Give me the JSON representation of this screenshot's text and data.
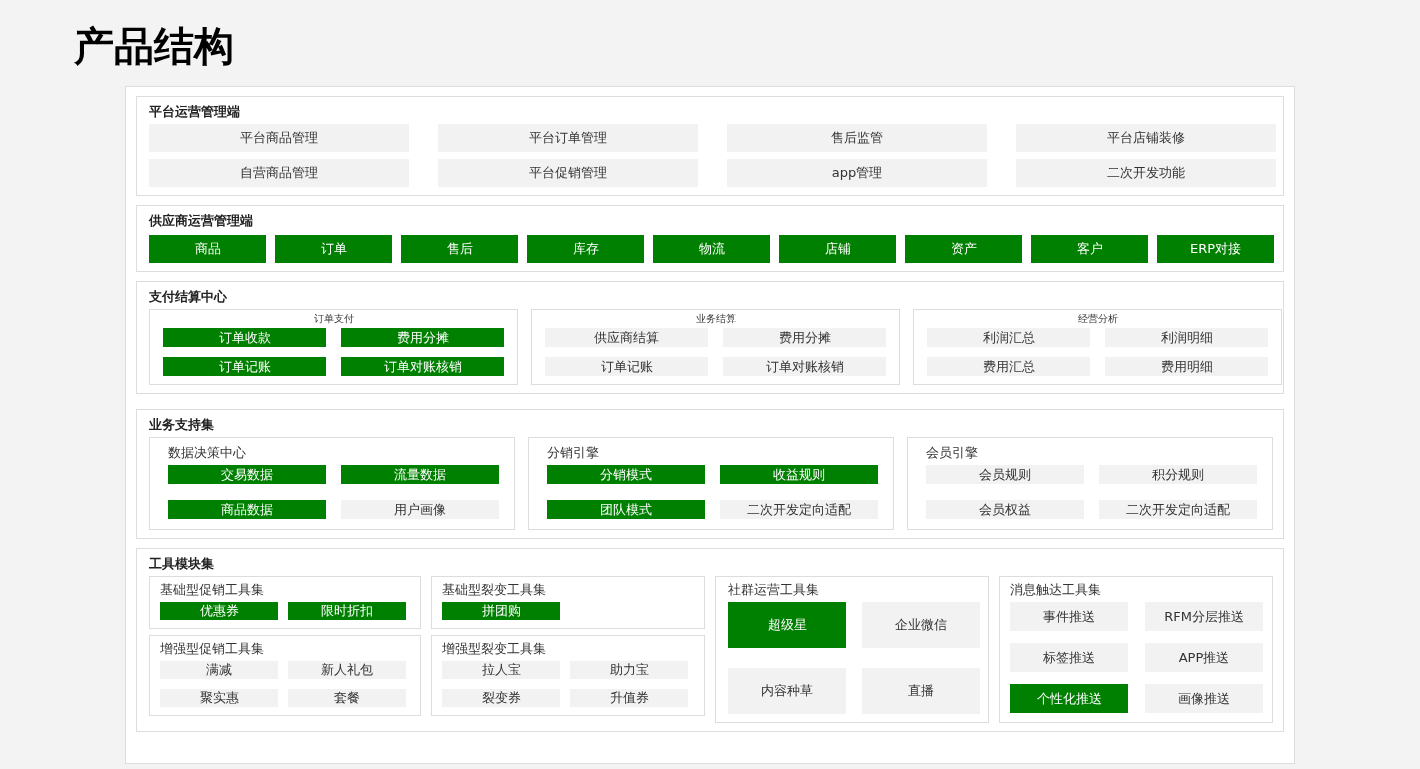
{
  "title": "产品结构",
  "sections": [
    {
      "kind": "tiles",
      "title": "平台运营管理端",
      "items": [
        {
          "label": "平台商品管理",
          "highlighted": false
        },
        {
          "label": "平台订单管理",
          "highlighted": false
        },
        {
          "label": "售后监管",
          "highlighted": false
        },
        {
          "label": "平台店铺装修",
          "highlighted": false
        },
        {
          "label": "自营商品管理",
          "highlighted": false
        },
        {
          "label": "平台促销管理",
          "highlighted": false
        },
        {
          "label": "app管理",
          "highlighted": false
        },
        {
          "label": "二次开发功能",
          "highlighted": false
        }
      ]
    },
    {
      "kind": "strip",
      "title": "供应商运营管理端",
      "items": [
        {
          "label": "商品",
          "highlighted": true
        },
        {
          "label": "订单",
          "highlighted": true
        },
        {
          "label": "售后",
          "highlighted": true
        },
        {
          "label": "库存",
          "highlighted": true
        },
        {
          "label": "物流",
          "highlighted": true
        },
        {
          "label": "店铺",
          "highlighted": true
        },
        {
          "label": "资产",
          "highlighted": true
        },
        {
          "label": "客户",
          "highlighted": true
        },
        {
          "label": "ERP对接",
          "highlighted": true
        }
      ]
    },
    {
      "kind": "compact-groups",
      "title": "支付结算中心",
      "groups": [
        {
          "title": "订单支付",
          "items": [
            {
              "label": "订单收款",
              "highlighted": true
            },
            {
              "label": "费用分摊",
              "highlighted": true
            },
            {
              "label": "订单记账",
              "highlighted": true
            },
            {
              "label": "订单对账核销",
              "highlighted": true
            }
          ]
        },
        {
          "title": "业务结算",
          "items": [
            {
              "label": "供应商结算",
              "highlighted": false
            },
            {
              "label": "费用分摊",
              "highlighted": false
            },
            {
              "label": "订单记账",
              "highlighted": false
            },
            {
              "label": "订单对账核销",
              "highlighted": false
            }
          ]
        },
        {
          "title": "经营分析",
          "items": [
            {
              "label": "利润汇总",
              "highlighted": false
            },
            {
              "label": "利润明细",
              "highlighted": false
            },
            {
              "label": "费用汇总",
              "highlighted": false
            },
            {
              "label": "费用明细",
              "highlighted": false
            }
          ]
        }
      ]
    },
    {
      "kind": "groups",
      "title": "业务支持集",
      "groups": [
        {
          "title": "数据决策中心",
          "items": [
            {
              "label": "交易数据",
              "highlighted": true
            },
            {
              "label": "流量数据",
              "highlighted": true
            },
            {
              "label": "商品数据",
              "highlighted": true
            },
            {
              "label": "用户画像",
              "highlighted": false
            }
          ]
        },
        {
          "title": "分销引擎",
          "items": [
            {
              "label": "分销模式",
              "highlighted": true
            },
            {
              "label": "收益规则",
              "highlighted": true
            },
            {
              "label": "团队模式",
              "highlighted": true
            },
            {
              "label": "二次开发定向适配",
              "highlighted": false
            }
          ]
        },
        {
          "title": "会员引擎",
          "items": [
            {
              "label": "会员规则",
              "highlighted": false
            },
            {
              "label": "积分规则",
              "highlighted": false
            },
            {
              "label": "会员权益",
              "highlighted": false
            },
            {
              "label": "二次开发定向适配",
              "highlighted": false
            }
          ]
        }
      ]
    },
    {
      "kind": "tools",
      "title": "工具模块集",
      "columns": [
        {
          "groups": [
            {
              "kind": "small",
              "title": "基础型促销工具集",
              "items": [
                {
                  "label": "优惠券",
                  "highlighted": true
                },
                {
                  "label": "限时折扣",
                  "highlighted": true
                }
              ]
            },
            {
              "kind": "small",
              "title": "增强型促销工具集",
              "items": [
                {
                  "label": "满减",
                  "highlighted": false
                },
                {
                  "label": "新人礼包",
                  "highlighted": false
                },
                {
                  "label": "聚实惠",
                  "highlighted": false
                },
                {
                  "label": "套餐",
                  "highlighted": false
                }
              ]
            }
          ]
        },
        {
          "groups": [
            {
              "kind": "small",
              "title": "基础型裂变工具集",
              "items": [
                {
                  "label": "拼团购",
                  "highlighted": true
                }
              ]
            },
            {
              "kind": "small",
              "title": "增强型裂变工具集",
              "items": [
                {
                  "label": "拉人宝",
                  "highlighted": false
                },
                {
                  "label": "助力宝",
                  "highlighted": false
                },
                {
                  "label": "裂变券",
                  "highlighted": false
                },
                {
                  "label": "升值券",
                  "highlighted": false
                }
              ]
            }
          ]
        },
        {
          "groups": [
            {
              "kind": "large",
              "title": "社群运营工具集",
              "items": [
                {
                  "label": "超级星",
                  "highlighted": true
                },
                {
                  "label": "企业微信",
                  "highlighted": false
                },
                {
                  "label": "内容种草",
                  "highlighted": false
                },
                {
                  "label": "直播",
                  "highlighted": false
                }
              ]
            }
          ]
        },
        {
          "groups": [
            {
              "kind": "medium",
              "title": "消息触达工具集",
              "items": [
                {
                  "label": "事件推送",
                  "highlighted": false
                },
                {
                  "label": "RFM分层推送",
                  "highlighted": false
                },
                {
                  "label": "标签推送",
                  "highlighted": false
                },
                {
                  "label": "APP推送",
                  "highlighted": false
                },
                {
                  "label": "个性化推送",
                  "highlighted": true
                },
                {
                  "label": "画像推送",
                  "highlighted": false
                }
              ]
            }
          ]
        }
      ]
    }
  ]
}
